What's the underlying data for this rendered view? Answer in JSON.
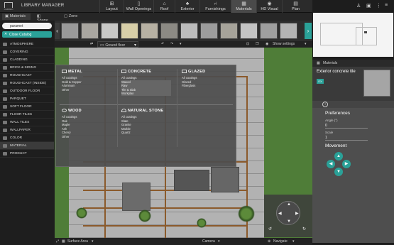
{
  "app": {
    "logo_text": "CEDREO",
    "title": "LIBRARY MANAGER"
  },
  "top_tabs": [
    {
      "label": "Layout",
      "icon": "layout-icon"
    },
    {
      "label": "Wall Openings",
      "icon": "wall-openings-icon"
    },
    {
      "label": "Roof",
      "icon": "roof-icon"
    },
    {
      "label": "Exterior",
      "icon": "exterior-icon"
    },
    {
      "label": "Furnishings",
      "icon": "furnishings-icon"
    },
    {
      "label": "Materials",
      "icon": "materials-icon"
    },
    {
      "label": "HD Visual",
      "icon": "camera-icon"
    },
    {
      "label": "Plan",
      "icon": "plan-icon"
    }
  ],
  "mode_tabs": [
    {
      "label": "Materials"
    },
    {
      "label": "Shape"
    },
    {
      "label": "Zone"
    }
  ],
  "search": {
    "value": "paramet"
  },
  "close_catalog": "Close Catalog",
  "categories": [
    "ATMOSPHERE",
    "COVERING",
    "CLADDING",
    "BRICK & SIDING",
    "ROUGHCAST",
    "ROUGHCAST (INSIDE)",
    "OUTDOOR FLOOR",
    "PARQUET",
    "SOFT FLOOR",
    "FLOOR TILES",
    "WALL TILES",
    "WALLPAPER",
    "COLOR",
    "MATERIAL",
    "PRODUCT"
  ],
  "active_category": "MATERIAL",
  "toolbar": {
    "floor": "Ground floor",
    "show_settings": "Show settings"
  },
  "menu": {
    "metal": {
      "title": "METAL",
      "items": [
        "All coatings",
        "Gold & Copper",
        "Aluminum",
        "Other"
      ]
    },
    "concrete": {
      "title": "CONCRETE",
      "items": [
        "All coatings",
        "Waxed",
        "Raw",
        "Tile & Slab",
        "Workplan"
      ]
    },
    "glazed": {
      "title": "GLAZED",
      "items": [
        "All coatings",
        "Glazed",
        "Fiberglass"
      ]
    },
    "wood": {
      "title": "WOOD",
      "items": [
        "All coatings",
        "Oak",
        "Maple",
        "Ash",
        "Cherry",
        "Other"
      ]
    },
    "natural_stone": {
      "title": "NATURAL STONE",
      "items": [
        "All coatings",
        "Slate",
        "Granite",
        "Marble",
        "Quartz"
      ]
    }
  },
  "bottom_bar": {
    "surface_area": "Surface Area",
    "camera": "Camera",
    "navigate": "Navigate"
  },
  "right_panel": {
    "tab": "Materials",
    "selected_title": "Exterior concrete tile",
    "selected_badge": "EX",
    "info_icon": "i",
    "preferences": "Preferences",
    "angle_label": "Angle (°)",
    "angle_value": "0",
    "scale_label": "Scale",
    "scale_value": "1",
    "movement": "Movement"
  },
  "colors": {
    "accent": "#2aa198",
    "grass": "#4f7d38",
    "wood_beam": "#8b5a2b"
  }
}
